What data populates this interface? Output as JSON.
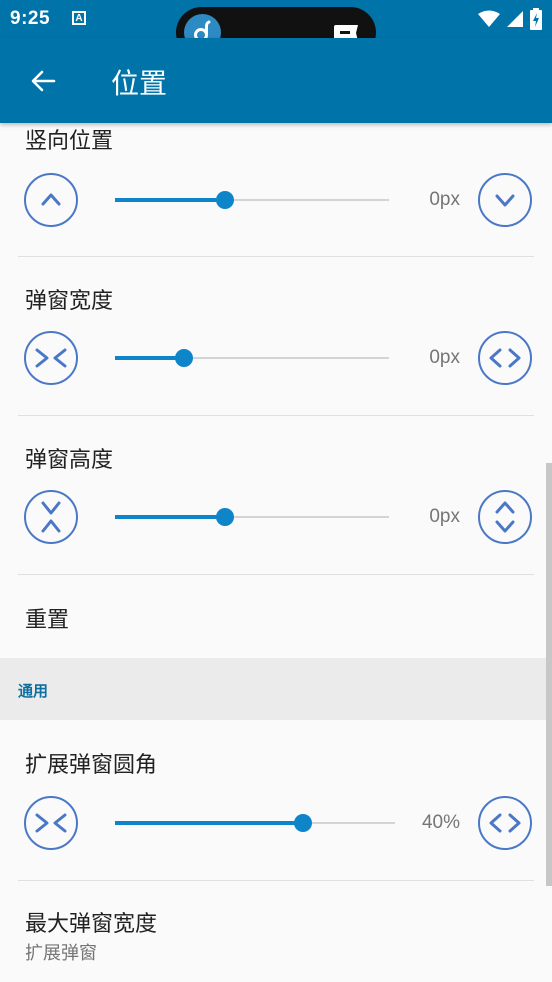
{
  "status_bar": {
    "time": "9:25",
    "notification_icon": "a-icon",
    "island_app_icon": "app-d-icon",
    "island_ticket_icon": "ticket-icon",
    "icons": [
      "wifi-icon",
      "signal-icon",
      "battery-charging-icon"
    ],
    "color": "#0073a8"
  },
  "app_bar": {
    "back_icon": "arrow-left-icon",
    "title": "位置"
  },
  "settings": {
    "vertical_position": {
      "title": "竖向位置",
      "value": "0px",
      "level": 0.4,
      "decrease_icon": "chevron-up-icon",
      "increase_icon": "chevron-down-icon"
    },
    "popup_width": {
      "title": "弹窗宽度",
      "value": "0px",
      "level": 0.25,
      "decrease_icon": "shrink-horizontal-icon",
      "increase_icon": "expand-horizontal-icon"
    },
    "popup_height": {
      "title": "弹窗高度",
      "value": "0px",
      "level": 0.4,
      "decrease_icon": "shrink-vertical-icon",
      "increase_icon": "expand-vertical-icon"
    },
    "reset": {
      "title": "重置"
    },
    "category_general": {
      "label": "通用"
    },
    "expanded_corner": {
      "title": "扩展弹窗圆角",
      "value": "40%",
      "level": 0.67,
      "decrease_icon": "shrink-horizontal-icon",
      "increase_icon": "expand-horizontal-icon"
    },
    "max_width": {
      "title": "最大弹窗宽度",
      "subtitle": "扩展弹窗"
    }
  },
  "colors": {
    "accent": "#0f85c9",
    "icon_button": "#4a78c7",
    "category_text": "#0f6f9f"
  }
}
